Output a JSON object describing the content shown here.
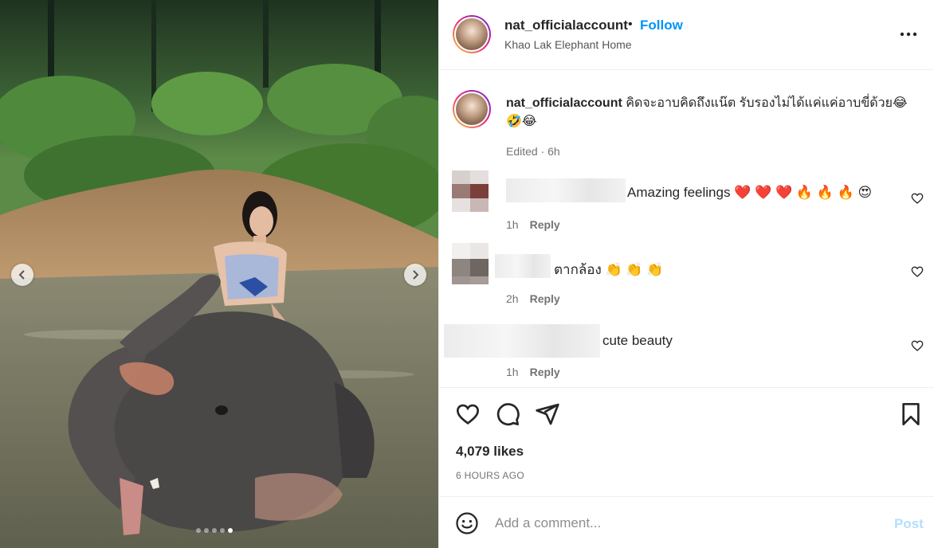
{
  "post": {
    "username": "nat_officialaccount",
    "separator": "•",
    "follow_label": "Follow",
    "location": "Khao Lak Elephant Home",
    "more_icon": "more-horizontal-icon"
  },
  "caption": {
    "username": "nat_officialaccount",
    "text": "คิดจะอาบคิดถึงแน๊ต รับรองไม่ได้แค่แค่อาบขี่ด้วย😂🤣😂",
    "meta": "Edited · 6h"
  },
  "comments": [
    {
      "text": "Amazing feelings ❤️ ❤️ ❤️ 🔥 🔥 🔥 😍",
      "time": "1h",
      "reply": "Reply"
    },
    {
      "text": "ตากล้อง 👏 👏 👏",
      "time": "2h",
      "reply": "Reply"
    },
    {
      "text": "cute beauty",
      "time": "1h",
      "reply": "Reply"
    }
  ],
  "stats": {
    "likes": "4,079 likes",
    "time_ago": "6 HOURS AGO"
  },
  "composer": {
    "placeholder": "Add a comment...",
    "post_label": "Post"
  },
  "carousel": {
    "slide_count": 5,
    "active_index": 4
  },
  "colors": {
    "accent": "#0095f6",
    "post_disabled": "#b2dffc",
    "muted": "#737373"
  }
}
